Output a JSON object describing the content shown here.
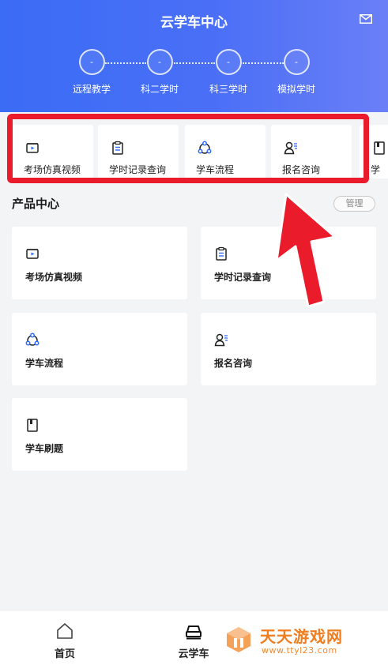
{
  "header": {
    "title": "云学车中心"
  },
  "steps": [
    {
      "value": "-",
      "label": "远程教学"
    },
    {
      "value": "-",
      "label": "科二学时"
    },
    {
      "value": "-",
      "label": "科三学时"
    },
    {
      "value": "-",
      "label": "模拟学时"
    }
  ],
  "quick_items": [
    {
      "label": "考场仿真视频",
      "icon": "video-icon"
    },
    {
      "label": "学时记录查询",
      "icon": "clipboard-icon"
    },
    {
      "label": "学车流程",
      "icon": "flow-icon"
    },
    {
      "label": "报名咨询",
      "icon": "user-list-icon"
    },
    {
      "label": "学",
      "icon": "book-icon"
    }
  ],
  "products": {
    "title": "产品中心",
    "manage_label": "管理",
    "items": [
      {
        "label": "考场仿真视频",
        "icon": "video-icon"
      },
      {
        "label": "学时记录查询",
        "icon": "clipboard-icon"
      },
      {
        "label": "学车流程",
        "icon": "flow-icon"
      },
      {
        "label": "报名咨询",
        "icon": "user-list-icon"
      },
      {
        "label": "学车刷题",
        "icon": "book-icon"
      }
    ]
  },
  "tabbar": [
    {
      "label": "首页",
      "icon": "home-icon"
    },
    {
      "label": "云学车",
      "icon": "car-icon"
    }
  ],
  "watermark": {
    "title": "天天游戏网",
    "url": "www.ttyl23.com"
  },
  "colors": {
    "accent": "#3b6cf5",
    "highlight": "#ea1c2c",
    "icon_blue": "#2f6bff",
    "watermark": "#f07d1f"
  }
}
